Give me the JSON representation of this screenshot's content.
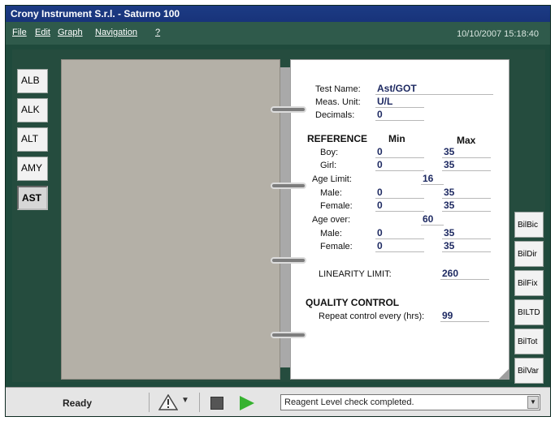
{
  "window": {
    "title": "Crony Instrument S.r.l. - Saturno 100"
  },
  "menubar": {
    "items": [
      "File",
      "Edit",
      "Graph",
      "Navigation",
      "?"
    ],
    "datetime": "10/10/2007  15:18:40"
  },
  "left_tabs": [
    "ALB",
    "ALK",
    "ALT",
    "AMY",
    "AST"
  ],
  "active_left_tab": "AST",
  "form": {
    "test_name_label": "Test Name:",
    "test_name_value": "Ast/GOT",
    "meas_unit_label": "Meas. Unit:",
    "meas_unit_value": "U/L",
    "decimals_label": "Decimals:",
    "decimals_value": "0",
    "reference_heading": "REFERENCE",
    "min_heading": "Min",
    "max_heading": "Max",
    "boy_label": "Boy:",
    "boy_min": "0",
    "boy_max": "35",
    "girl_label": "Girl:",
    "girl_min": "0",
    "girl_max": "35",
    "age_limit_label": "Age Limit:",
    "age_limit_value": "16",
    "male1_label": "Male:",
    "male1_min": "0",
    "male1_max": "35",
    "female1_label": "Female:",
    "female1_min": "0",
    "female1_max": "35",
    "age_over_label": "Age over:",
    "age_over_value": "60",
    "male2_label": "Male:",
    "male2_min": "0",
    "male2_max": "35",
    "female2_label": "Female:",
    "female2_min": "0",
    "female2_max": "35",
    "linearity_label": "LINEARITY LIMIT:",
    "linearity_value": "260",
    "qc_heading": "QUALITY CONTROL",
    "repeat_label": "Repeat control every (hrs):",
    "repeat_value": "99"
  },
  "right_tabs": [
    "BilBic",
    "BilDir",
    "BilFix",
    "BILTD",
    "BilTot",
    "BilVar"
  ],
  "status": {
    "ready": "Ready",
    "message": "Reagent Level check completed."
  },
  "icons": {
    "warning": "warning-triangle-icon",
    "stop": "stop-icon",
    "play": "play-icon"
  }
}
